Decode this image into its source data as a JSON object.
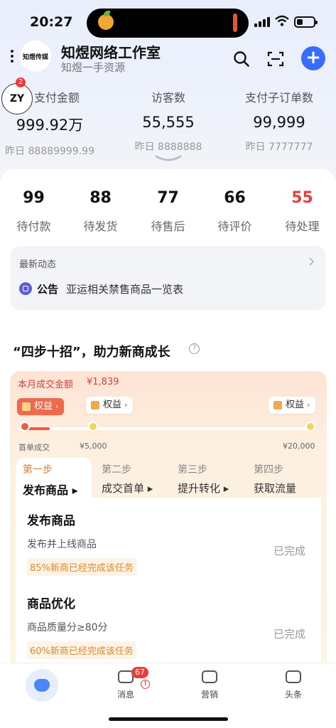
{
  "status_bar": {
    "time": "20:27"
  },
  "header": {
    "logo_text": "知煜传媒",
    "shop_name": "知煜网络工作室",
    "shop_subtitle": "知煜一手资源"
  },
  "account": {
    "avatar_text": "ZY",
    "badge_count": "2"
  },
  "metrics": [
    {
      "label": "支付金额",
      "value": "999.92万",
      "yesterday": "昨日 88889999.99"
    },
    {
      "label": "访客数",
      "value": "55,555",
      "yesterday": "昨日 8888888"
    },
    {
      "label": "支付子订单数",
      "value": "99,999",
      "yesterday": "昨日 7777777"
    }
  ],
  "order_counts": [
    {
      "count": "99",
      "label": "待付款"
    },
    {
      "count": "88",
      "label": "待发货"
    },
    {
      "count": "77",
      "label": "待售后"
    },
    {
      "count": "66",
      "label": "待评价"
    },
    {
      "count": "55",
      "label": "待处理"
    }
  ],
  "news": {
    "title": "最新动态",
    "tag": "公告",
    "text": "亚运相关禁售商品一览表"
  },
  "growth": {
    "section_title": "“四步十招”，助力新商成长",
    "help_glyph": "?",
    "gmv_label": "本月成交金额",
    "gmv_value": "¥1,839",
    "benefit_label": "权益",
    "progress_fraction": 0.09,
    "milestones": [
      "首单成交",
      "¥5,000",
      "¥20,000"
    ],
    "steps": [
      {
        "num": "第一步",
        "name": "发布商品 ▸"
      },
      {
        "num": "第二步",
        "name": "成交首单 ▸"
      },
      {
        "num": "第三步",
        "name": "提升转化 ▸"
      },
      {
        "num": "第四步",
        "name": "获取流量"
      }
    ],
    "tasks": [
      {
        "title": "发布商品",
        "desc": "发布并上线商品",
        "pct": "85%新商已经完成该任务",
        "status": "已完成"
      },
      {
        "title": "商品优化",
        "desc": "商品质量分≥80分",
        "pct": "60%新商已经完成该任务",
        "status": "已完成"
      }
    ]
  },
  "bottom_nav": {
    "items": [
      {
        "label": "消息"
      },
      {
        "label": "营销"
      },
      {
        "label": "头条"
      }
    ],
    "message_badge": "67",
    "alert_glyph": "!"
  },
  "colors": {
    "accent": "#3a6bff",
    "alert": "#e5403b",
    "growth_orange": "#ee6a4d"
  }
}
